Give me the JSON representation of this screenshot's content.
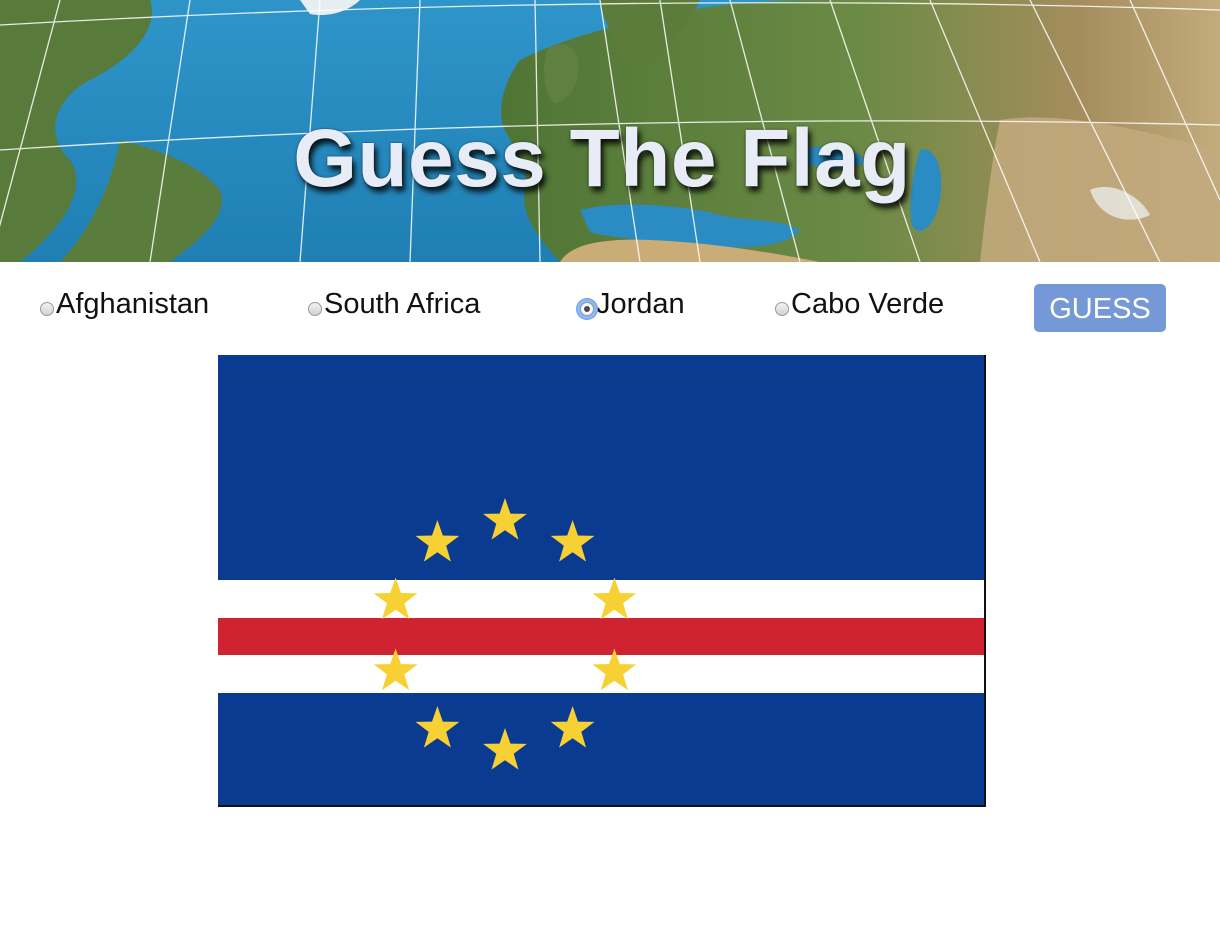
{
  "title": "Guess The Flag",
  "options": [
    {
      "label": "Afghanistan",
      "checked": false
    },
    {
      "label": "South Africa",
      "checked": false
    },
    {
      "label": "Jordan",
      "checked": true
    },
    {
      "label": "Cabo Verde",
      "checked": false
    }
  ],
  "guess_button": {
    "label": "GUESS"
  },
  "flag": {
    "colors": {
      "blue": "#0b3a91",
      "white": "#ffffff",
      "red": "#cf2331",
      "star": "#f7d034"
    },
    "star_count": 10
  },
  "header_colors": {
    "ocean": "#2d8fc4",
    "land_green": "#5e7f3a",
    "land_tan": "#b69a6a",
    "grid": "#ffffff",
    "title": "#e8ecf6"
  },
  "button_color": "#7499d6"
}
